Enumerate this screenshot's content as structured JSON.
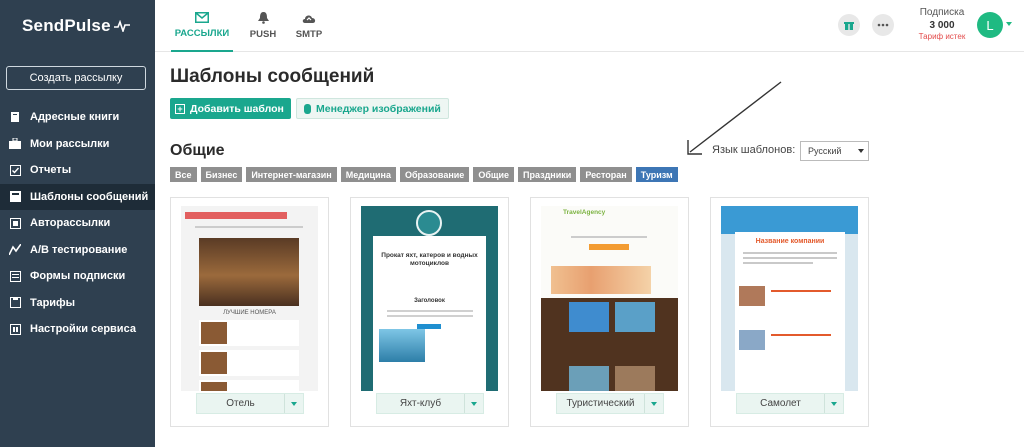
{
  "app": {
    "logo": "SendPulse",
    "create_button": "Создать рассылку"
  },
  "sidebar": {
    "items": [
      {
        "label": "Адресные книги",
        "icon": "book-icon"
      },
      {
        "label": "Мои рассылки",
        "icon": "briefcase-icon"
      },
      {
        "label": "Отчеты",
        "icon": "checkbox-icon"
      },
      {
        "label": "Шаблоны сообщений",
        "icon": "template-icon",
        "active": true
      },
      {
        "label": "Авторассылки",
        "icon": "automation-icon"
      },
      {
        "label": "A/B тестирование",
        "icon": "ab-test-icon"
      },
      {
        "label": "Формы подписки",
        "icon": "form-icon"
      },
      {
        "label": "Тарифы",
        "icon": "pricing-icon"
      },
      {
        "label": "Настройки сервиса",
        "icon": "settings-icon"
      }
    ]
  },
  "topbar": {
    "tabs": [
      {
        "label": "РАССЫЛКИ",
        "icon": "mail-icon",
        "active": true
      },
      {
        "label": "PUSH",
        "icon": "bell-icon"
      },
      {
        "label": "SMTP",
        "icon": "cloud-upload-icon"
      }
    ],
    "subscription": {
      "label": "Подписка",
      "count": "3 000",
      "status": "Тариф истек"
    },
    "avatar_letter": "L"
  },
  "main": {
    "title": "Шаблоны сообщений",
    "add_template": "Добавить шаблон",
    "image_manager": "Менеджер изображений",
    "section_title": "Общие",
    "language_label": "Язык шаблонов:",
    "language_value": "Русский",
    "categories": [
      {
        "label": "Все"
      },
      {
        "label": "Бизнес"
      },
      {
        "label": "Интернет-магазин"
      },
      {
        "label": "Медицина"
      },
      {
        "label": "Образование"
      },
      {
        "label": "Общие"
      },
      {
        "label": "Праздники"
      },
      {
        "label": "Ресторан"
      },
      {
        "label": "Туризм",
        "active": true
      }
    ],
    "templates": [
      {
        "label": "Отель"
      },
      {
        "label": "Яхт-клуб"
      },
      {
        "label": "Туристический"
      },
      {
        "label": "Самолет"
      }
    ]
  },
  "thumbnails": {
    "hotel_section": "ЛУЧШИЕ НОМЕРА",
    "yacht_title": "Прокат яхт, катеров и водных мотоциклов",
    "yacht_heading": "Заголовок",
    "travel_brand": "TravelAgency",
    "plane_title": "Название компании"
  },
  "colors": {
    "sidebar_bg": "#2f4050",
    "accent": "#1aa78e",
    "active_category": "#3d76b5",
    "category_bg": "#8f8f8f",
    "avatar": "#1fba82"
  }
}
